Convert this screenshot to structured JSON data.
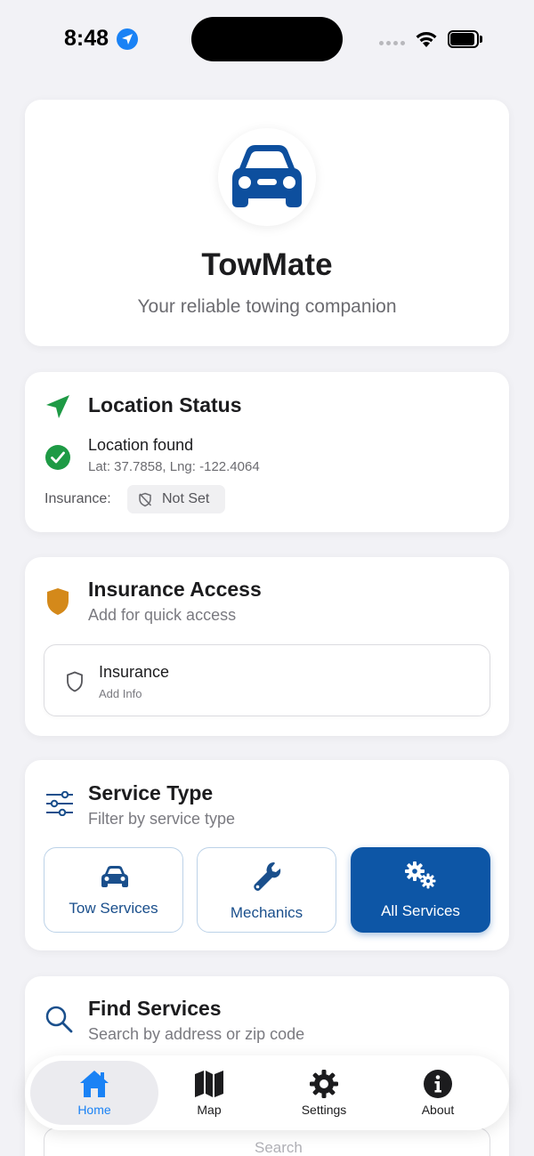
{
  "status_bar": {
    "time": "8:48"
  },
  "header": {
    "app_name": "TowMate",
    "tagline": "Your reliable towing companion"
  },
  "location_status": {
    "title": "Location Status",
    "state": "Location found",
    "coordinates": "Lat: 37.7858, Lng: -122.4064",
    "insurance_label": "Insurance:",
    "insurance_value": "Not Set"
  },
  "insurance_access": {
    "title": "Insurance Access",
    "subtitle": "Add for quick access",
    "item_title": "Insurance",
    "item_subtitle": "Add Info"
  },
  "service_type": {
    "title": "Service Type",
    "subtitle": "Filter by service type",
    "options": [
      {
        "label": "Tow Services",
        "icon": "car-icon",
        "selected": false
      },
      {
        "label": "Mechanics",
        "icon": "wrench-icon",
        "selected": false
      },
      {
        "label": "All Services",
        "icon": "gears-icon",
        "selected": true
      }
    ]
  },
  "find_services": {
    "title": "Find Services",
    "subtitle": "Search by address or zip code",
    "search_placeholder": "Search"
  },
  "tabbar": {
    "tabs": [
      {
        "label": "Home",
        "icon": "home-icon",
        "active": true
      },
      {
        "label": "Map",
        "icon": "map-icon",
        "active": false
      },
      {
        "label": "Settings",
        "icon": "gear-icon",
        "active": false
      },
      {
        "label": "About",
        "icon": "info-icon",
        "active": false
      }
    ]
  },
  "colors": {
    "brand_blue": "#0d56a6",
    "tab_active": "#1a82f5",
    "success_green": "#1e9a45",
    "insurance_orange": "#d4891a"
  }
}
